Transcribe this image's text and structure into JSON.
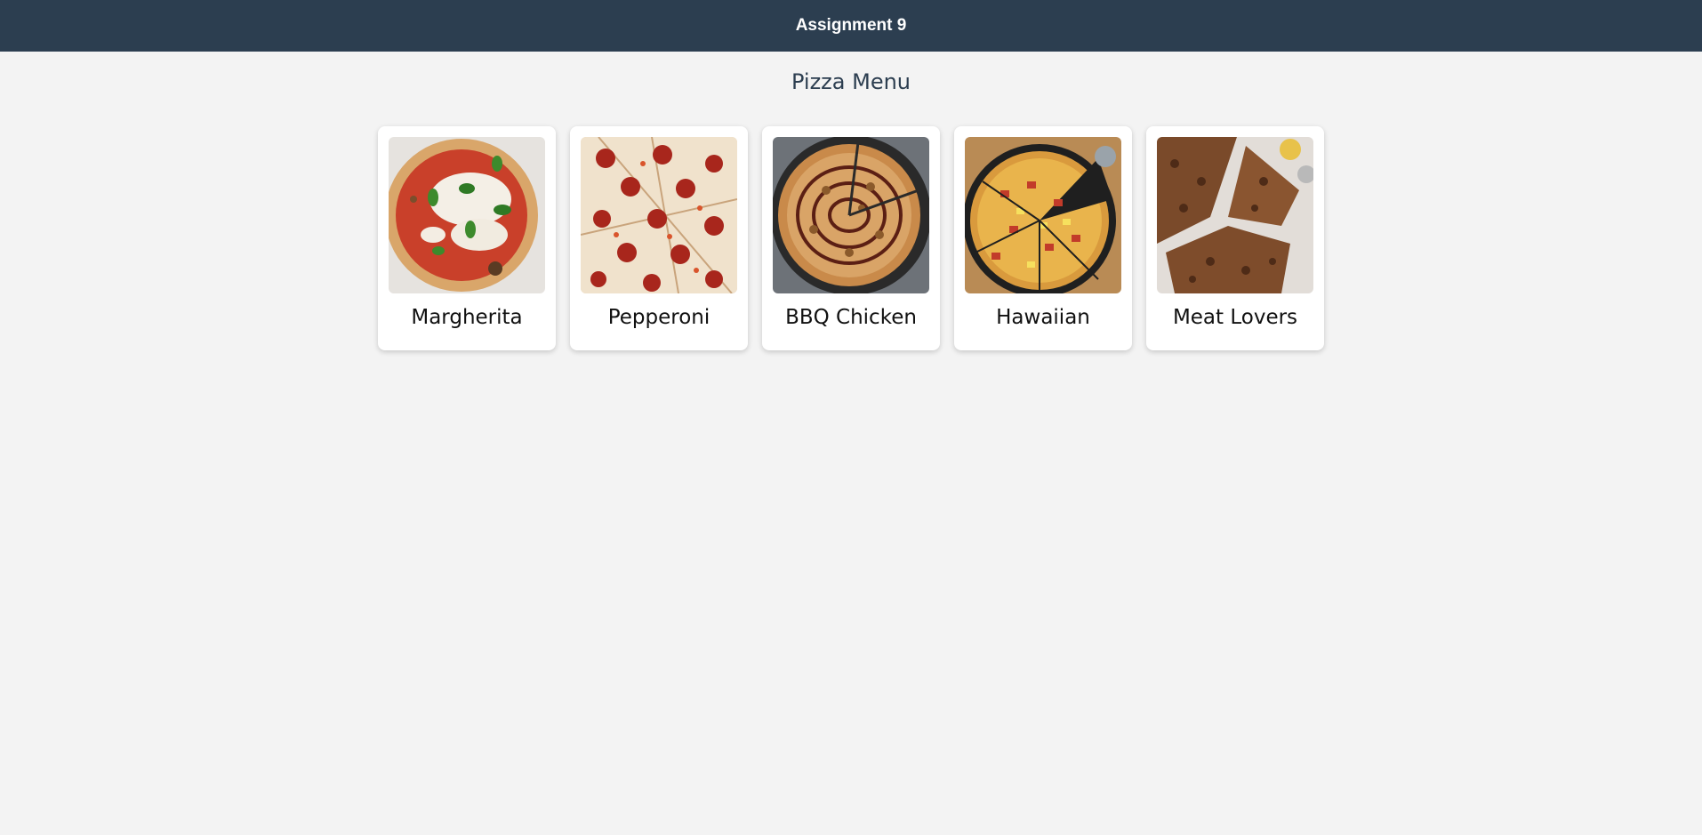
{
  "header": {
    "title": "Assignment 9"
  },
  "main": {
    "title": "Pizza Menu",
    "pizzas": [
      {
        "name": "Margherita",
        "image": "margherita-pizza-image"
      },
      {
        "name": "Pepperoni",
        "image": "pepperoni-pizza-image"
      },
      {
        "name": "BBQ Chicken",
        "image": "bbq-chicken-pizza-image"
      },
      {
        "name": "Hawaiian",
        "image": "hawaiian-pizza-image"
      },
      {
        "name": "Meat Lovers",
        "image": "meat-lovers-pizza-image"
      }
    ]
  },
  "colors": {
    "header_bg": "#2c3e50",
    "page_bg": "#f3f3f3",
    "card_bg": "#ffffff",
    "title_text": "#2c3e50"
  }
}
